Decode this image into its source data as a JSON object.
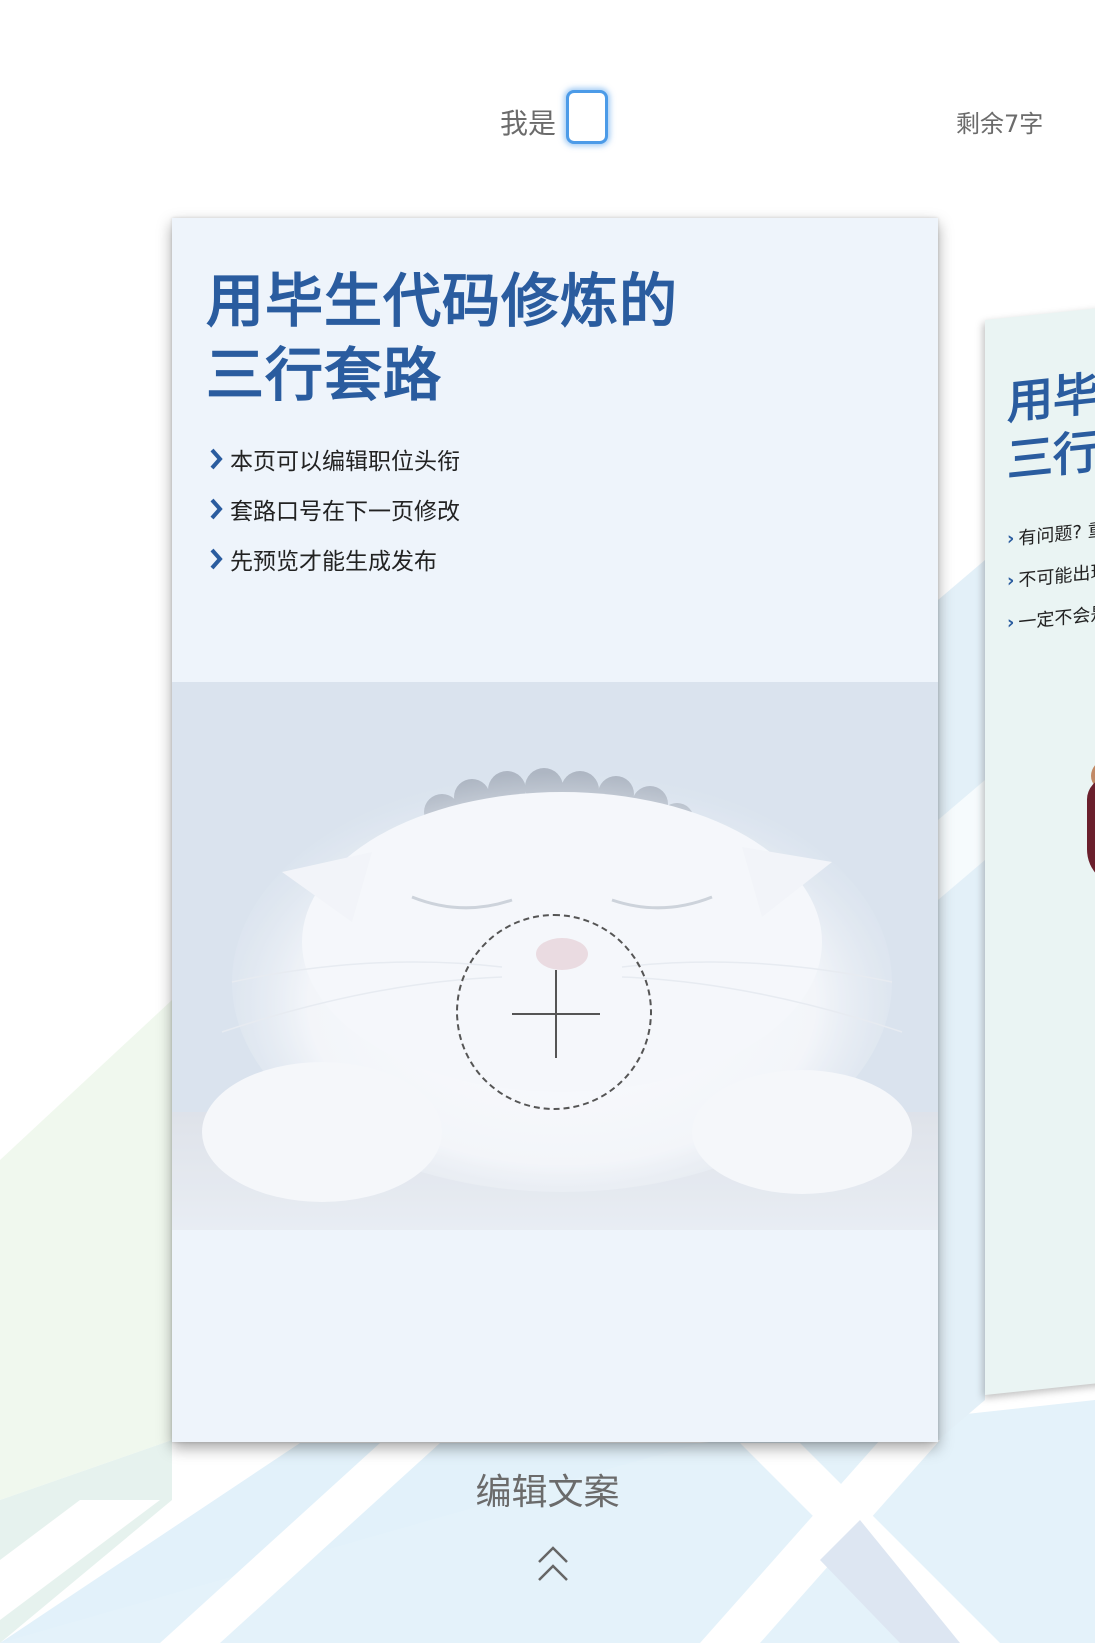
{
  "header": {
    "name_label": "我是",
    "name_value": "",
    "remaining_text": "剩余7字"
  },
  "card": {
    "title_line1": "用毕生代码修炼的",
    "title_line2": "三行套路",
    "bullets": [
      "本页可以编辑职位头衔",
      "套路口号在下一页修改",
      "先预览才能生成发布"
    ],
    "photo_icon": "plus-icon"
  },
  "next_card": {
    "title_line1": "用毕",
    "title_line2": "三行",
    "bullets": [
      "有问题? 重",
      "不可能出现",
      "一定不会是"
    ]
  },
  "footer": {
    "edit_label": "编辑文案",
    "arrow_icon": "double-chevron-up-icon"
  },
  "colors": {
    "accent_blue": "#2a5c9f",
    "input_border": "#4c9be8",
    "card_bg": "#eef4fb",
    "muted_text": "#6b6b6b"
  }
}
